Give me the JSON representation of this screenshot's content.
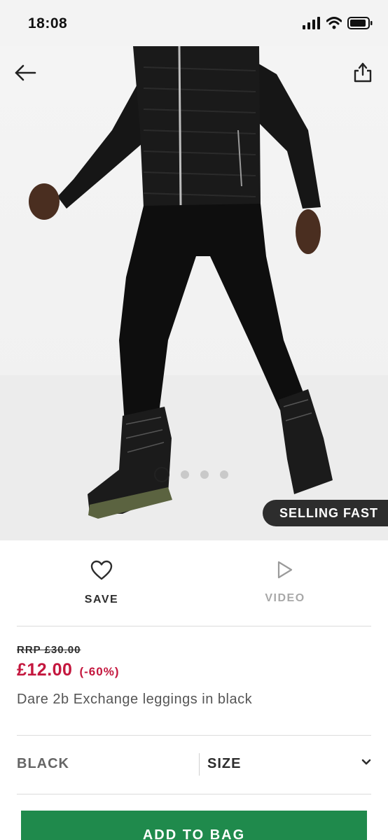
{
  "status_bar": {
    "time": "18:08",
    "icons": [
      "signal-icon",
      "wifi-icon",
      "battery-icon"
    ]
  },
  "hero": {
    "nav_icons": [
      "back-arrow-icon",
      "share-icon"
    ],
    "carousel": {
      "total": 4,
      "active": 1
    },
    "badge": "SELLING FAST"
  },
  "actions": {
    "save_label": "SAVE",
    "video_label": "VIDEO",
    "icons": [
      "heart-icon",
      "play-icon"
    ]
  },
  "product": {
    "rrp": "RRP £30.00",
    "price": "£12.00",
    "discount": "(-60%)",
    "name": "Dare 2b Exchange leggings in black"
  },
  "options": {
    "colour": "BLACK",
    "size_label": "SIZE",
    "size_icon": "chevron-down-icon"
  },
  "cta": {
    "add_to_bag": "ADD TO BAG"
  },
  "colors": {
    "price_red": "#c4173e",
    "cta_green": "#1f8a4c",
    "badge_bg": "#2d2d2d",
    "muted_grey": "#a8a8a8"
  }
}
